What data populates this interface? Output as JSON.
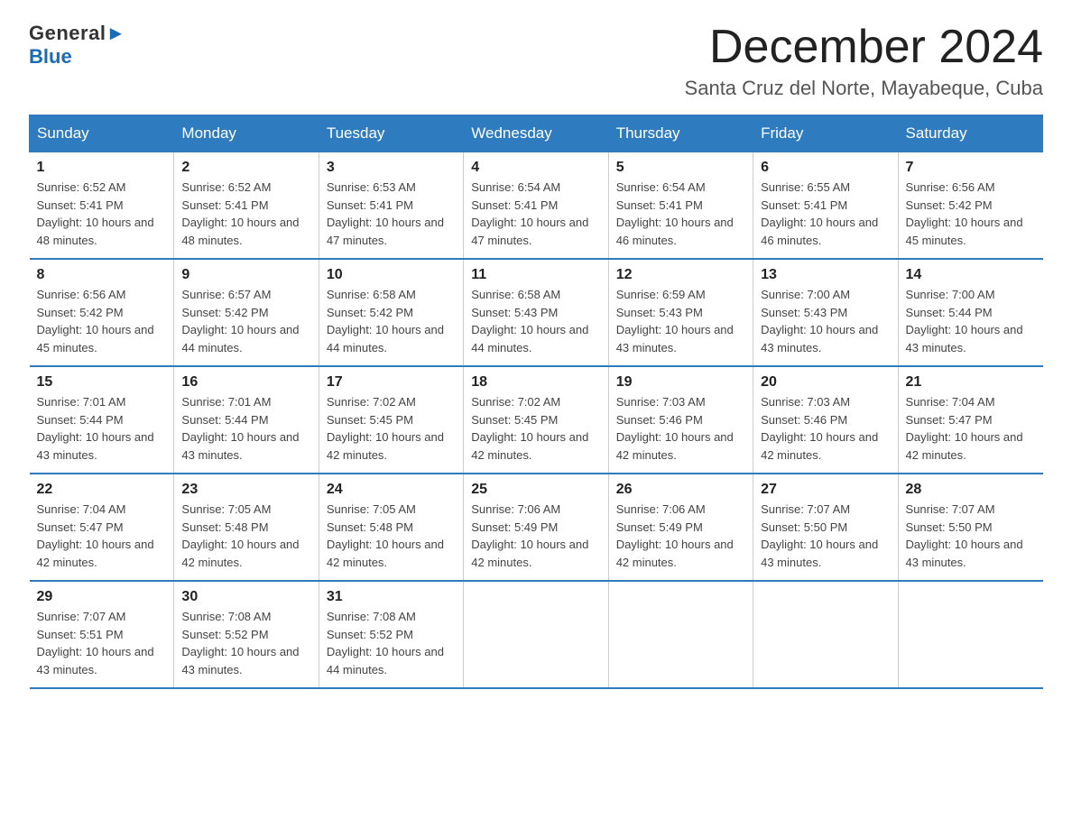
{
  "logo": {
    "general": "General",
    "blue": "Blue",
    "arrow": "▶"
  },
  "header": {
    "month_title": "December 2024",
    "location": "Santa Cruz del Norte, Mayabeque, Cuba"
  },
  "days_of_week": [
    "Sunday",
    "Monday",
    "Tuesday",
    "Wednesday",
    "Thursday",
    "Friday",
    "Saturday"
  ],
  "weeks": [
    [
      {
        "day": "1",
        "sunrise": "6:52 AM",
        "sunset": "5:41 PM",
        "daylight": "10 hours and 48 minutes."
      },
      {
        "day": "2",
        "sunrise": "6:52 AM",
        "sunset": "5:41 PM",
        "daylight": "10 hours and 48 minutes."
      },
      {
        "day": "3",
        "sunrise": "6:53 AM",
        "sunset": "5:41 PM",
        "daylight": "10 hours and 47 minutes."
      },
      {
        "day": "4",
        "sunrise": "6:54 AM",
        "sunset": "5:41 PM",
        "daylight": "10 hours and 47 minutes."
      },
      {
        "day": "5",
        "sunrise": "6:54 AM",
        "sunset": "5:41 PM",
        "daylight": "10 hours and 46 minutes."
      },
      {
        "day": "6",
        "sunrise": "6:55 AM",
        "sunset": "5:41 PM",
        "daylight": "10 hours and 46 minutes."
      },
      {
        "day": "7",
        "sunrise": "6:56 AM",
        "sunset": "5:42 PM",
        "daylight": "10 hours and 45 minutes."
      }
    ],
    [
      {
        "day": "8",
        "sunrise": "6:56 AM",
        "sunset": "5:42 PM",
        "daylight": "10 hours and 45 minutes."
      },
      {
        "day": "9",
        "sunrise": "6:57 AM",
        "sunset": "5:42 PM",
        "daylight": "10 hours and 44 minutes."
      },
      {
        "day": "10",
        "sunrise": "6:58 AM",
        "sunset": "5:42 PM",
        "daylight": "10 hours and 44 minutes."
      },
      {
        "day": "11",
        "sunrise": "6:58 AM",
        "sunset": "5:43 PM",
        "daylight": "10 hours and 44 minutes."
      },
      {
        "day": "12",
        "sunrise": "6:59 AM",
        "sunset": "5:43 PM",
        "daylight": "10 hours and 43 minutes."
      },
      {
        "day": "13",
        "sunrise": "7:00 AM",
        "sunset": "5:43 PM",
        "daylight": "10 hours and 43 minutes."
      },
      {
        "day": "14",
        "sunrise": "7:00 AM",
        "sunset": "5:44 PM",
        "daylight": "10 hours and 43 minutes."
      }
    ],
    [
      {
        "day": "15",
        "sunrise": "7:01 AM",
        "sunset": "5:44 PM",
        "daylight": "10 hours and 43 minutes."
      },
      {
        "day": "16",
        "sunrise": "7:01 AM",
        "sunset": "5:44 PM",
        "daylight": "10 hours and 43 minutes."
      },
      {
        "day": "17",
        "sunrise": "7:02 AM",
        "sunset": "5:45 PM",
        "daylight": "10 hours and 42 minutes."
      },
      {
        "day": "18",
        "sunrise": "7:02 AM",
        "sunset": "5:45 PM",
        "daylight": "10 hours and 42 minutes."
      },
      {
        "day": "19",
        "sunrise": "7:03 AM",
        "sunset": "5:46 PM",
        "daylight": "10 hours and 42 minutes."
      },
      {
        "day": "20",
        "sunrise": "7:03 AM",
        "sunset": "5:46 PM",
        "daylight": "10 hours and 42 minutes."
      },
      {
        "day": "21",
        "sunrise": "7:04 AM",
        "sunset": "5:47 PM",
        "daylight": "10 hours and 42 minutes."
      }
    ],
    [
      {
        "day": "22",
        "sunrise": "7:04 AM",
        "sunset": "5:47 PM",
        "daylight": "10 hours and 42 minutes."
      },
      {
        "day": "23",
        "sunrise": "7:05 AM",
        "sunset": "5:48 PM",
        "daylight": "10 hours and 42 minutes."
      },
      {
        "day": "24",
        "sunrise": "7:05 AM",
        "sunset": "5:48 PM",
        "daylight": "10 hours and 42 minutes."
      },
      {
        "day": "25",
        "sunrise": "7:06 AM",
        "sunset": "5:49 PM",
        "daylight": "10 hours and 42 minutes."
      },
      {
        "day": "26",
        "sunrise": "7:06 AM",
        "sunset": "5:49 PM",
        "daylight": "10 hours and 42 minutes."
      },
      {
        "day": "27",
        "sunrise": "7:07 AM",
        "sunset": "5:50 PM",
        "daylight": "10 hours and 43 minutes."
      },
      {
        "day": "28",
        "sunrise": "7:07 AM",
        "sunset": "5:50 PM",
        "daylight": "10 hours and 43 minutes."
      }
    ],
    [
      {
        "day": "29",
        "sunrise": "7:07 AM",
        "sunset": "5:51 PM",
        "daylight": "10 hours and 43 minutes."
      },
      {
        "day": "30",
        "sunrise": "7:08 AM",
        "sunset": "5:52 PM",
        "daylight": "10 hours and 43 minutes."
      },
      {
        "day": "31",
        "sunrise": "7:08 AM",
        "sunset": "5:52 PM",
        "daylight": "10 hours and 44 minutes."
      },
      null,
      null,
      null,
      null
    ]
  ]
}
